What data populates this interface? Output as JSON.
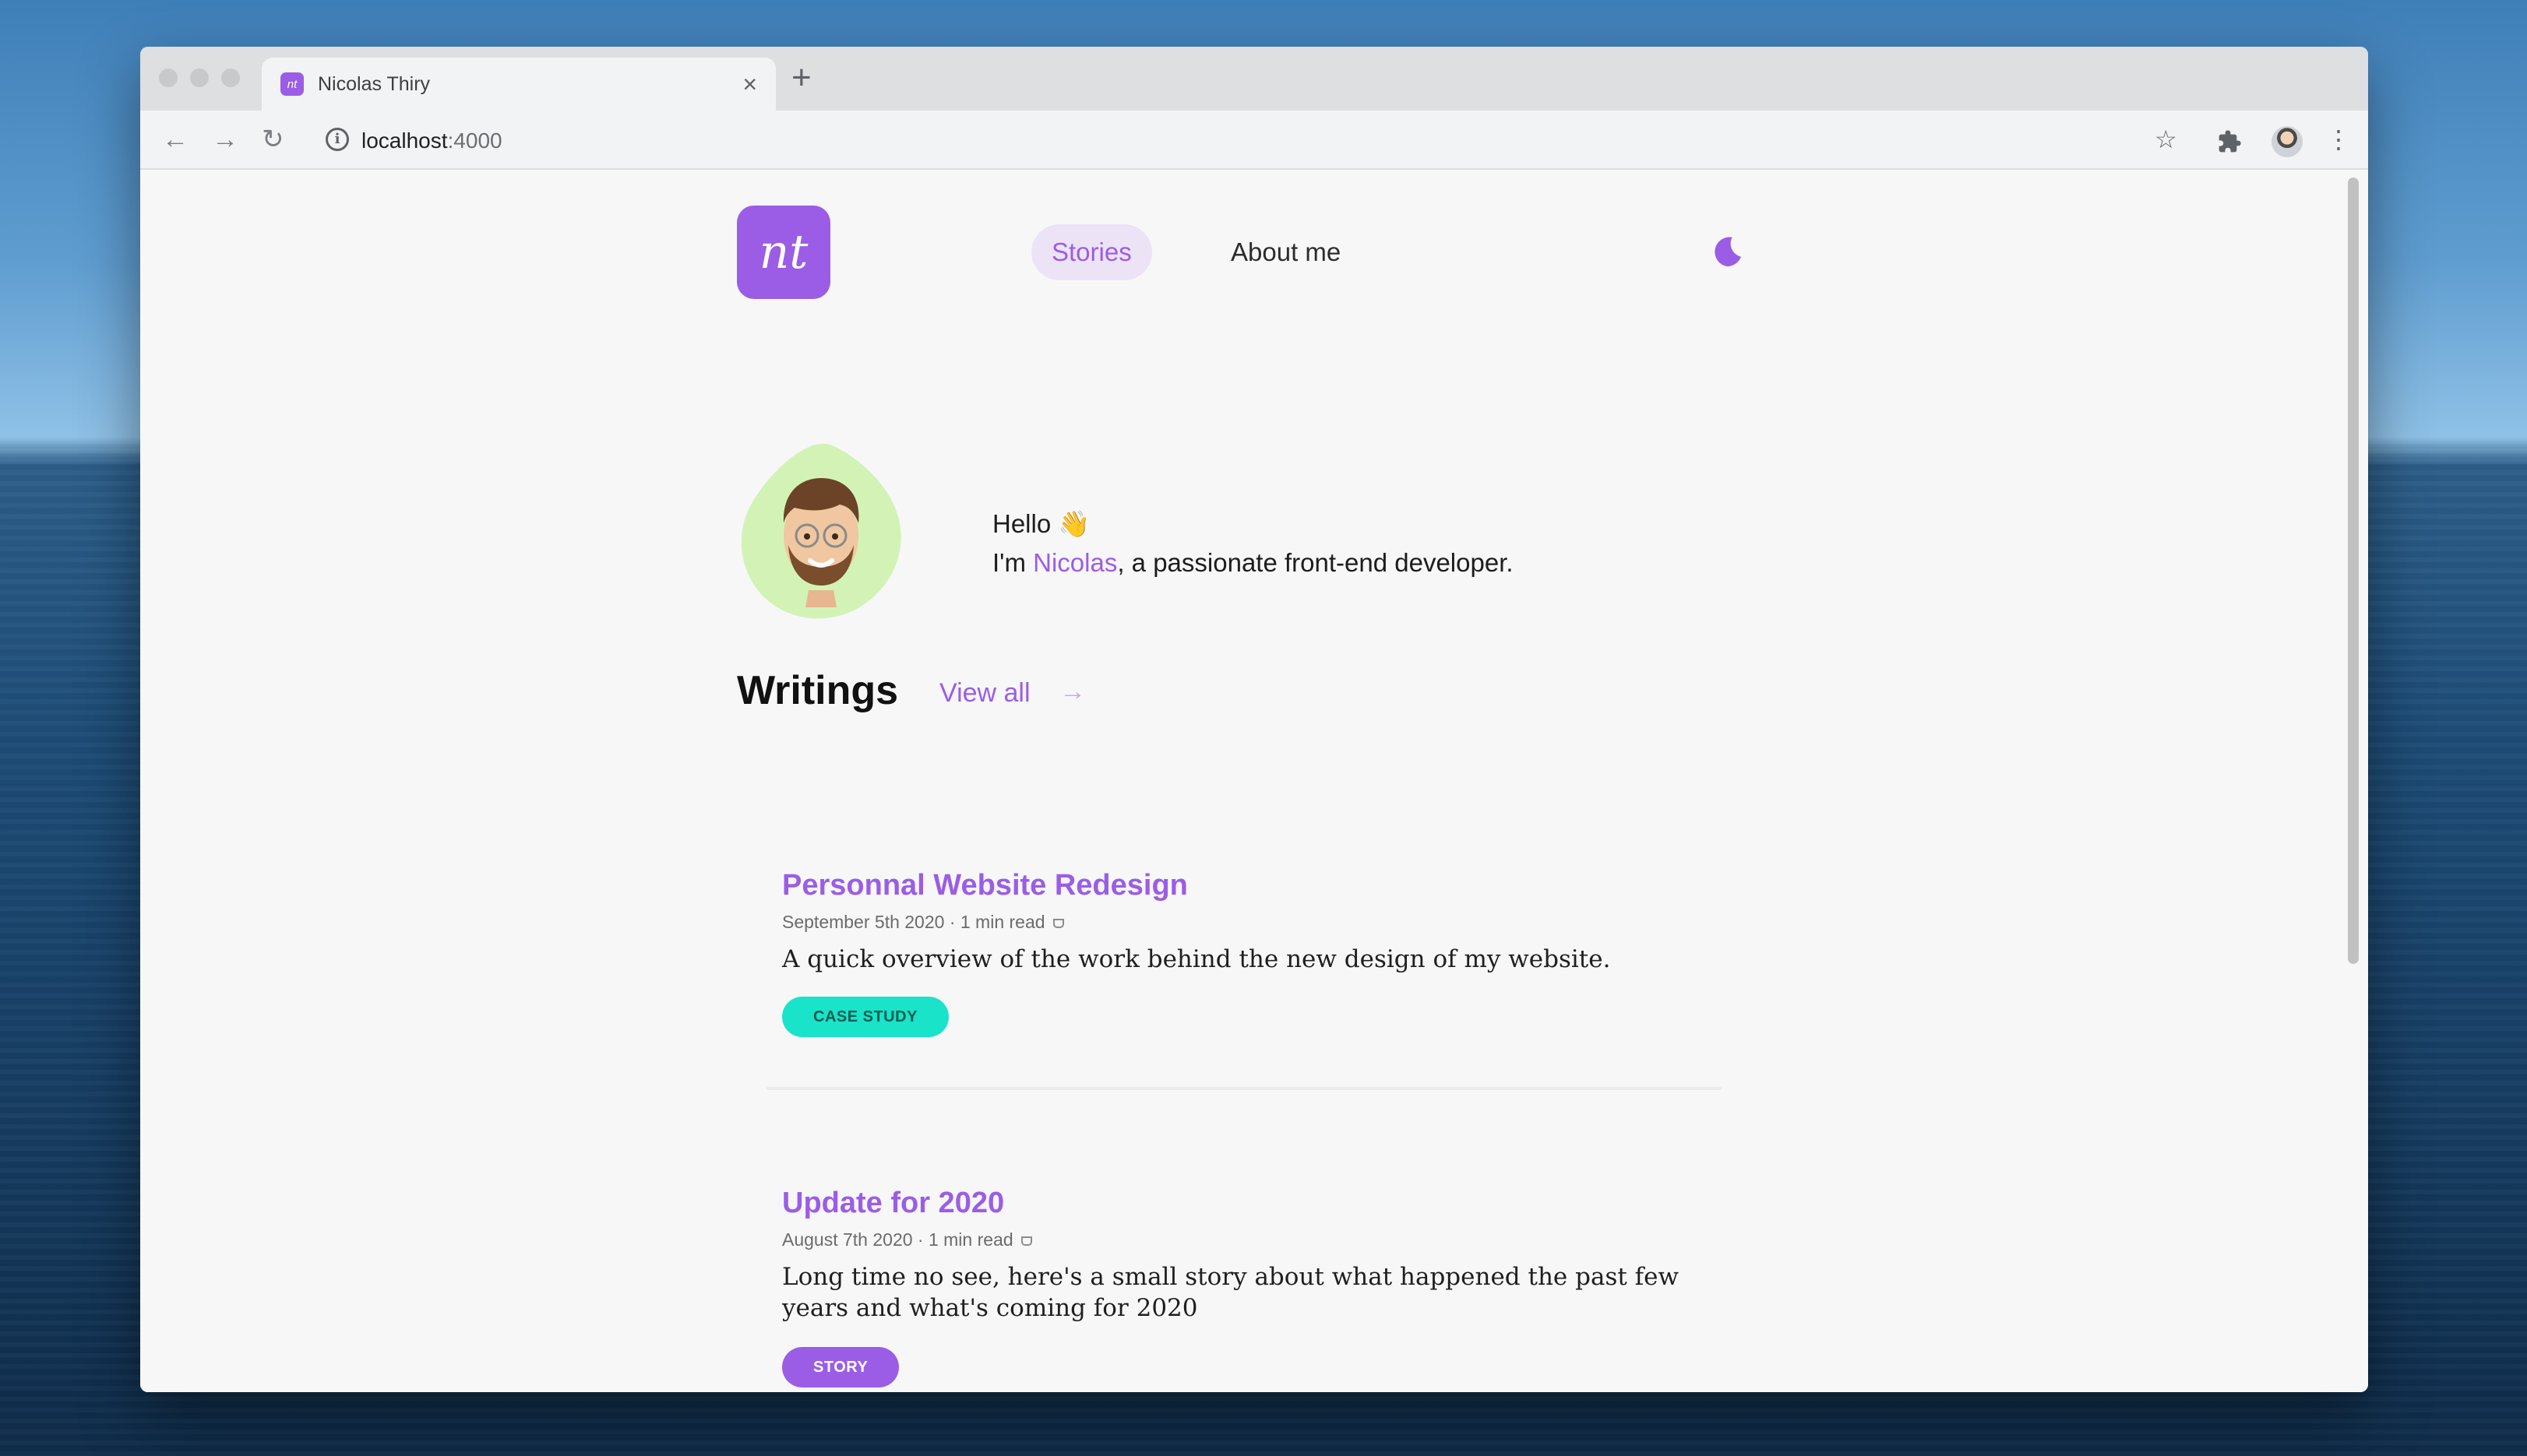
{
  "browser": {
    "tab_title": "Nicolas Thiry",
    "tab_favicon_text": "nt",
    "tab_close": "×",
    "new_tab": "+",
    "url_host": "localhost",
    "url_port": ":4000",
    "icons": {
      "back": "back-arrow-icon",
      "forward": "forward-arrow-icon",
      "reload": "reload-icon",
      "info": "info-icon",
      "bookmark": "star-icon",
      "extensions": "puzzle-icon",
      "menu": "kebab-menu-icon"
    }
  },
  "site": {
    "logo_text": "nt",
    "nav": {
      "stories": "Stories",
      "about": "About me"
    },
    "accent_color": "#9b5de5"
  },
  "hero": {
    "greeting": "Hello 👋",
    "intro_prefix": "I'm ",
    "name": "Nicolas",
    "intro_suffix": ", a passionate front-end developer."
  },
  "writings": {
    "heading": "Writings",
    "view_all": "View all",
    "arrow": "→",
    "posts": [
      {
        "title": "Personnal Website Redesign",
        "meta": "September 5th 2020 · 1 min read",
        "description": "A quick overview of the work behind the new design of my website.",
        "tag": "CASE STUDY",
        "tag_color": "#19e3c8"
      },
      {
        "title": "Update for 2020",
        "meta": "August 7th 2020 · 1 min read",
        "description": "Long time no see, here's a small story about what happened the past few years and what's coming for 2020",
        "tag": "STORY",
        "tag_color": "#9b5de5"
      }
    ]
  }
}
